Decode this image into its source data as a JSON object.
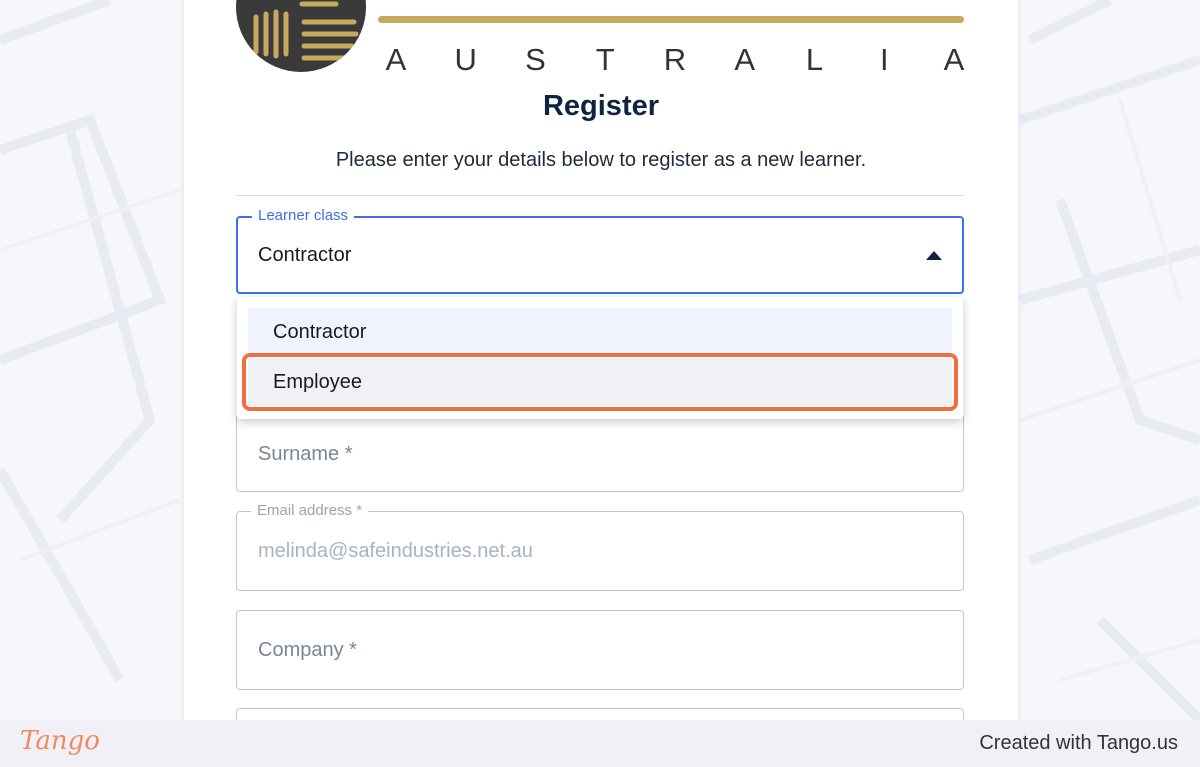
{
  "brand": {
    "wordmark_letters": [
      "A",
      "U",
      "S",
      "T",
      "R",
      "A",
      "L",
      "I",
      "A"
    ],
    "gold_color": "#c6a95f",
    "dark_color": "#3a3a3a"
  },
  "form": {
    "title": "Register",
    "subtitle": "Please enter your details below to register as a new learner.",
    "learner_class": {
      "label": "Learner class",
      "value": "Contractor",
      "options": [
        "Contractor",
        "Employee"
      ],
      "highlighted_option": "Employee"
    },
    "surname": {
      "placeholder": "Surname *"
    },
    "email": {
      "label": "Email address *",
      "value": "melinda@safeindustries.net.au"
    },
    "company": {
      "placeholder": "Company *"
    }
  },
  "colors": {
    "focus_blue": "#3f6ee6",
    "highlight_orange": "#f06e3f",
    "title_navy": "#102440"
  },
  "footer": {
    "logo": "Tango",
    "credit": "Created with Tango.us"
  }
}
